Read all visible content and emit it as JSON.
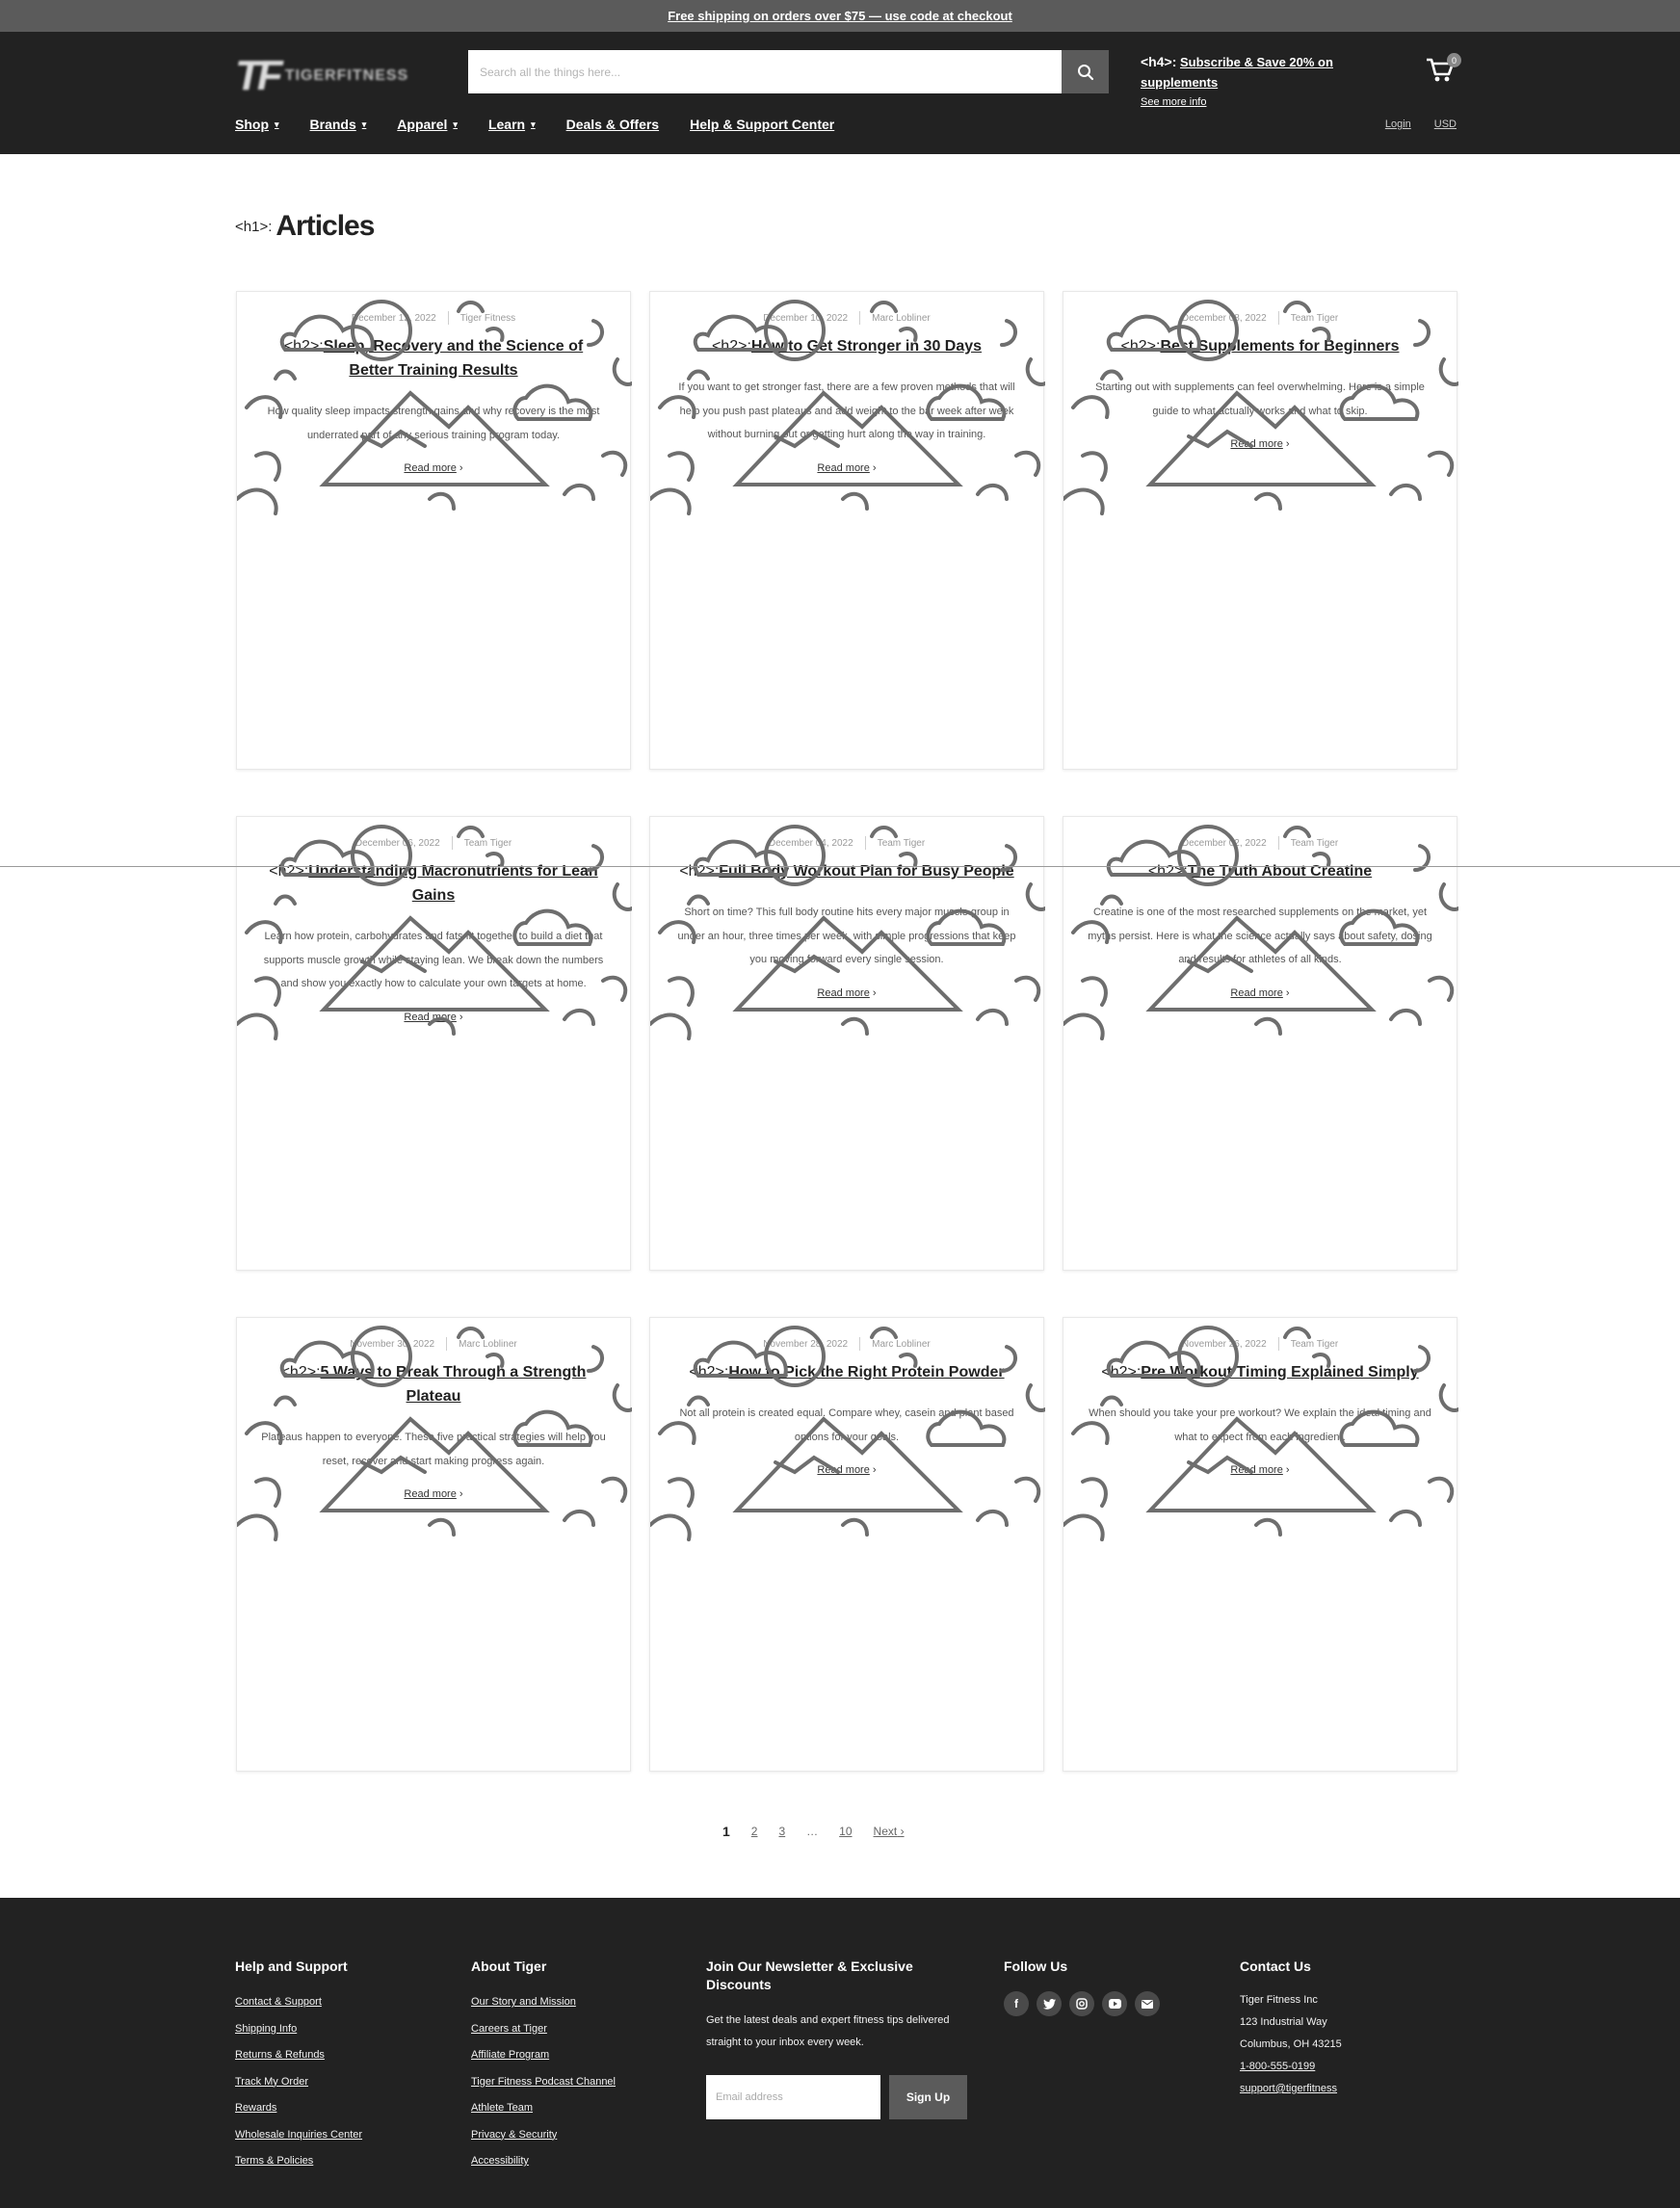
{
  "announcement": {
    "text": "Free shipping on orders over $75 — use code at checkout"
  },
  "header": {
    "logo_mark": "TF",
    "logo_word": "TIGERFITNESS",
    "search_placeholder": "Search all the things here...",
    "promo_tag": "<h4>:",
    "promo_line1": "Subscribe & Save 20% on supplements",
    "promo_line2": "See more info",
    "cart_count": "0"
  },
  "nav": {
    "items": [
      "Shop",
      "Brands",
      "Apparel",
      "Learn",
      "Deals & Offers",
      "Help & Support Center"
    ],
    "right": [
      "Login",
      "USD"
    ]
  },
  "page": {
    "tag": "<h1>:",
    "title": "Articles"
  },
  "cards": [
    {
      "date": "December 12, 2022",
      "author": "Tiger Fitness",
      "tag": "<h2>:",
      "title": "Sleep, Recovery and the Science of Better Training Results",
      "excerpt": "How quality sleep impacts strength gains and why recovery is the most underrated part of any serious training program today.",
      "more": "Read more"
    },
    {
      "date": "December 10, 2022",
      "author": "Marc Lobliner",
      "tag": "<h2>:",
      "title": "How to Get Stronger in 30 Days",
      "excerpt": "If you want to get stronger fast, there are a few proven methods that will help you push past plateaus and add weight to the bar week after week without burning out or getting hurt along the way in training.",
      "more": "Read more"
    },
    {
      "date": "December 08, 2022",
      "author": "Team Tiger",
      "tag": "<h2>:",
      "title": "Best Supplements for Beginners",
      "excerpt": "Starting out with supplements can feel overwhelming. Here is a simple guide to what actually works and what to skip.",
      "more": "Read more"
    },
    {
      "date": "December 06, 2022",
      "author": "Team Tiger",
      "tag": "<h2>:",
      "title": "Understanding Macronutrients for Lean Gains",
      "excerpt": "Learn how protein, carbohydrates and fats fit together to build a diet that supports muscle growth while staying lean. We break down the numbers and show you exactly how to calculate your own targets at home.",
      "more": "Read more"
    },
    {
      "date": "December 04, 2022",
      "author": "Team Tiger",
      "tag": "<h2>:",
      "title": "Full Body Workout Plan for Busy People",
      "excerpt": "Short on time? This full body routine hits every major muscle group in under an hour, three times per week, with simple progressions that keep you moving forward every single session.",
      "more": "Read more"
    },
    {
      "date": "December 02, 2022",
      "author": "Team Tiger",
      "tag": "<h2>:",
      "title": "The Truth About Creatine",
      "excerpt": "Creatine is one of the most researched supplements on the market, yet myths persist. Here is what the science actually says about safety, dosing and results for athletes of all kinds.",
      "more": "Read more"
    },
    {
      "date": "November 30, 2022",
      "author": "Marc Lobliner",
      "tag": "<h2>:",
      "title": "5 Ways to Break Through a Strength Plateau",
      "excerpt": "Plateaus happen to everyone. These five practical strategies will help you reset, recover and start making progress again.",
      "more": "Read more"
    },
    {
      "date": "November 28, 2022",
      "author": "Marc Lobliner",
      "tag": "<h2>:",
      "title": "How to Pick the Right Protein Powder",
      "excerpt": "Not all protein is created equal. Compare whey, casein and plant based options for your goals.",
      "more": "Read more"
    },
    {
      "date": "November 26, 2022",
      "author": "Team Tiger",
      "tag": "<h2>:",
      "title": "Pre Workout Timing Explained Simply",
      "excerpt": "When should you take your pre workout? We explain the ideal timing and what to expect from each ingredient.",
      "more": "Read more"
    }
  ],
  "pagination": {
    "current": "1",
    "pages": [
      "2",
      "3"
    ],
    "ellipsis": "…",
    "last": "10",
    "next": "Next"
  },
  "footer": {
    "col1": {
      "title": "Help and Support",
      "links": [
        "Contact & Support",
        "Shipping Info",
        "Returns & Refunds",
        "Track My Order",
        "Rewards",
        "Wholesale Inquiries Center",
        "Terms & Policies"
      ]
    },
    "col2": {
      "title": "About Tiger",
      "links": [
        "Our Story and Mission",
        "Careers at Tiger",
        "Affiliate Program",
        "Tiger Fitness Podcast Channel",
        "Athlete Team",
        "Privacy & Security",
        "Accessibility"
      ]
    },
    "col3": {
      "title": "Join Our Newsletter & Exclusive Discounts",
      "text": "Get the latest deals and expert fitness tips delivered straight to your inbox every week.",
      "placeholder": "Email address",
      "button": "Sign Up"
    },
    "col4": {
      "title": "Follow Us",
      "icons": [
        "facebook-icon",
        "twitter-icon",
        "instagram-icon",
        "youtube-icon",
        "email-icon"
      ]
    },
    "col5": {
      "title": "Contact Us",
      "lines": [
        "Tiger Fitness Inc",
        "123 Industrial Way",
        "Columbus, OH 43215",
        "1-800-555-0199",
        "support@tigerfitness"
      ]
    }
  },
  "colors": {
    "header_bg": "#222222",
    "announce_bg": "#5b5b5b",
    "image_placeholder": "#878787",
    "accent_button": "#5b5b5b"
  }
}
